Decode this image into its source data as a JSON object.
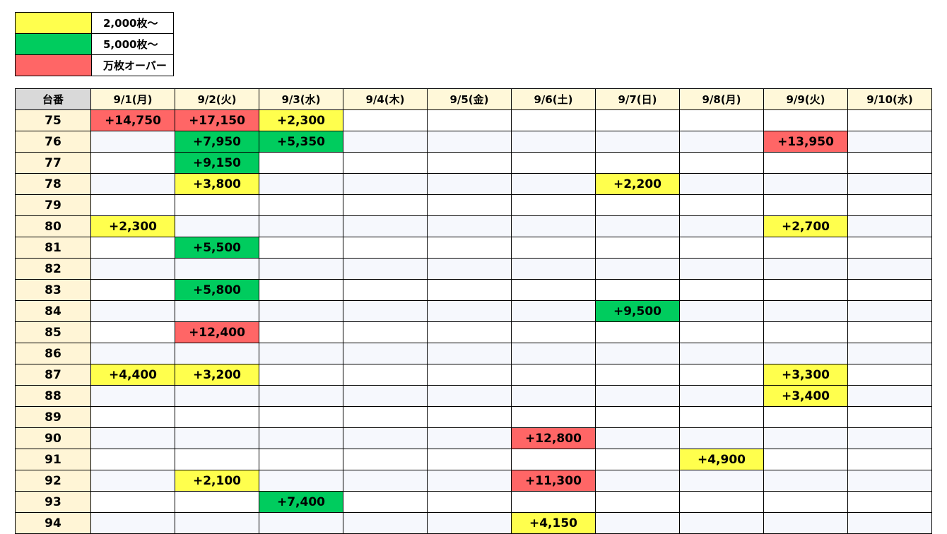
{
  "colors": {
    "yellow": "#ffff4d",
    "green": "#00cc5e",
    "red": "#ff6666"
  },
  "legend": [
    {
      "color": "yellow",
      "label": "2,000枚～"
    },
    {
      "color": "green",
      "label": "5,000枚～"
    },
    {
      "color": "red",
      "label": "万枚オーバー"
    }
  ],
  "table": {
    "corner": "台番",
    "dates": [
      "9/1(月)",
      "9/2(火)",
      "9/3(水)",
      "9/4(木)",
      "9/5(金)",
      "9/6(土)",
      "9/7(日)",
      "9/8(月)",
      "9/9(火)",
      "9/10(水)"
    ],
    "rows": [
      {
        "num": "75",
        "cells": [
          {
            "v": "+14,750",
            "c": "red"
          },
          {
            "v": "+17,150",
            "c": "red"
          },
          {
            "v": "+2,300",
            "c": "yellow"
          },
          null,
          null,
          null,
          null,
          null,
          null,
          null
        ]
      },
      {
        "num": "76",
        "cells": [
          null,
          {
            "v": "+7,950",
            "c": "green"
          },
          {
            "v": "+5,350",
            "c": "green"
          },
          null,
          null,
          null,
          null,
          null,
          {
            "v": "+13,950",
            "c": "red"
          },
          null
        ]
      },
      {
        "num": "77",
        "cells": [
          null,
          {
            "v": "+9,150",
            "c": "green"
          },
          null,
          null,
          null,
          null,
          null,
          null,
          null,
          null
        ]
      },
      {
        "num": "78",
        "cells": [
          null,
          {
            "v": "+3,800",
            "c": "yellow"
          },
          null,
          null,
          null,
          null,
          {
            "v": "+2,200",
            "c": "yellow"
          },
          null,
          null,
          null
        ]
      },
      {
        "num": "79",
        "cells": [
          null,
          null,
          null,
          null,
          null,
          null,
          null,
          null,
          null,
          null
        ]
      },
      {
        "num": "80",
        "cells": [
          {
            "v": "+2,300",
            "c": "yellow"
          },
          null,
          null,
          null,
          null,
          null,
          null,
          null,
          {
            "v": "+2,700",
            "c": "yellow"
          },
          null
        ]
      },
      {
        "num": "81",
        "cells": [
          null,
          {
            "v": "+5,500",
            "c": "green"
          },
          null,
          null,
          null,
          null,
          null,
          null,
          null,
          null
        ]
      },
      {
        "num": "82",
        "cells": [
          null,
          null,
          null,
          null,
          null,
          null,
          null,
          null,
          null,
          null
        ]
      },
      {
        "num": "83",
        "cells": [
          null,
          {
            "v": "+5,800",
            "c": "green"
          },
          null,
          null,
          null,
          null,
          null,
          null,
          null,
          null
        ]
      },
      {
        "num": "84",
        "cells": [
          null,
          null,
          null,
          null,
          null,
          null,
          {
            "v": "+9,500",
            "c": "green"
          },
          null,
          null,
          null
        ]
      },
      {
        "num": "85",
        "cells": [
          null,
          {
            "v": "+12,400",
            "c": "red"
          },
          null,
          null,
          null,
          null,
          null,
          null,
          null,
          null
        ]
      },
      {
        "num": "86",
        "cells": [
          null,
          null,
          null,
          null,
          null,
          null,
          null,
          null,
          null,
          null
        ]
      },
      {
        "num": "87",
        "cells": [
          {
            "v": "+4,400",
            "c": "yellow"
          },
          {
            "v": "+3,200",
            "c": "yellow"
          },
          null,
          null,
          null,
          null,
          null,
          null,
          {
            "v": "+3,300",
            "c": "yellow"
          },
          null
        ]
      },
      {
        "num": "88",
        "cells": [
          null,
          null,
          null,
          null,
          null,
          null,
          null,
          null,
          {
            "v": "+3,400",
            "c": "yellow"
          },
          null
        ]
      },
      {
        "num": "89",
        "cells": [
          null,
          null,
          null,
          null,
          null,
          null,
          null,
          null,
          null,
          null
        ]
      },
      {
        "num": "90",
        "cells": [
          null,
          null,
          null,
          null,
          null,
          {
            "v": "+12,800",
            "c": "red"
          },
          null,
          null,
          null,
          null
        ]
      },
      {
        "num": "91",
        "cells": [
          null,
          null,
          null,
          null,
          null,
          null,
          null,
          {
            "v": "+4,900",
            "c": "yellow"
          },
          null,
          null
        ]
      },
      {
        "num": "92",
        "cells": [
          null,
          {
            "v": "+2,100",
            "c": "yellow"
          },
          null,
          null,
          null,
          {
            "v": "+11,300",
            "c": "red"
          },
          null,
          null,
          null,
          null
        ]
      },
      {
        "num": "93",
        "cells": [
          null,
          null,
          {
            "v": "+7,400",
            "c": "green"
          },
          null,
          null,
          null,
          null,
          null,
          null,
          null
        ]
      },
      {
        "num": "94",
        "cells": [
          null,
          null,
          null,
          null,
          null,
          {
            "v": "+4,150",
            "c": "yellow"
          },
          null,
          null,
          null,
          null
        ]
      }
    ]
  }
}
